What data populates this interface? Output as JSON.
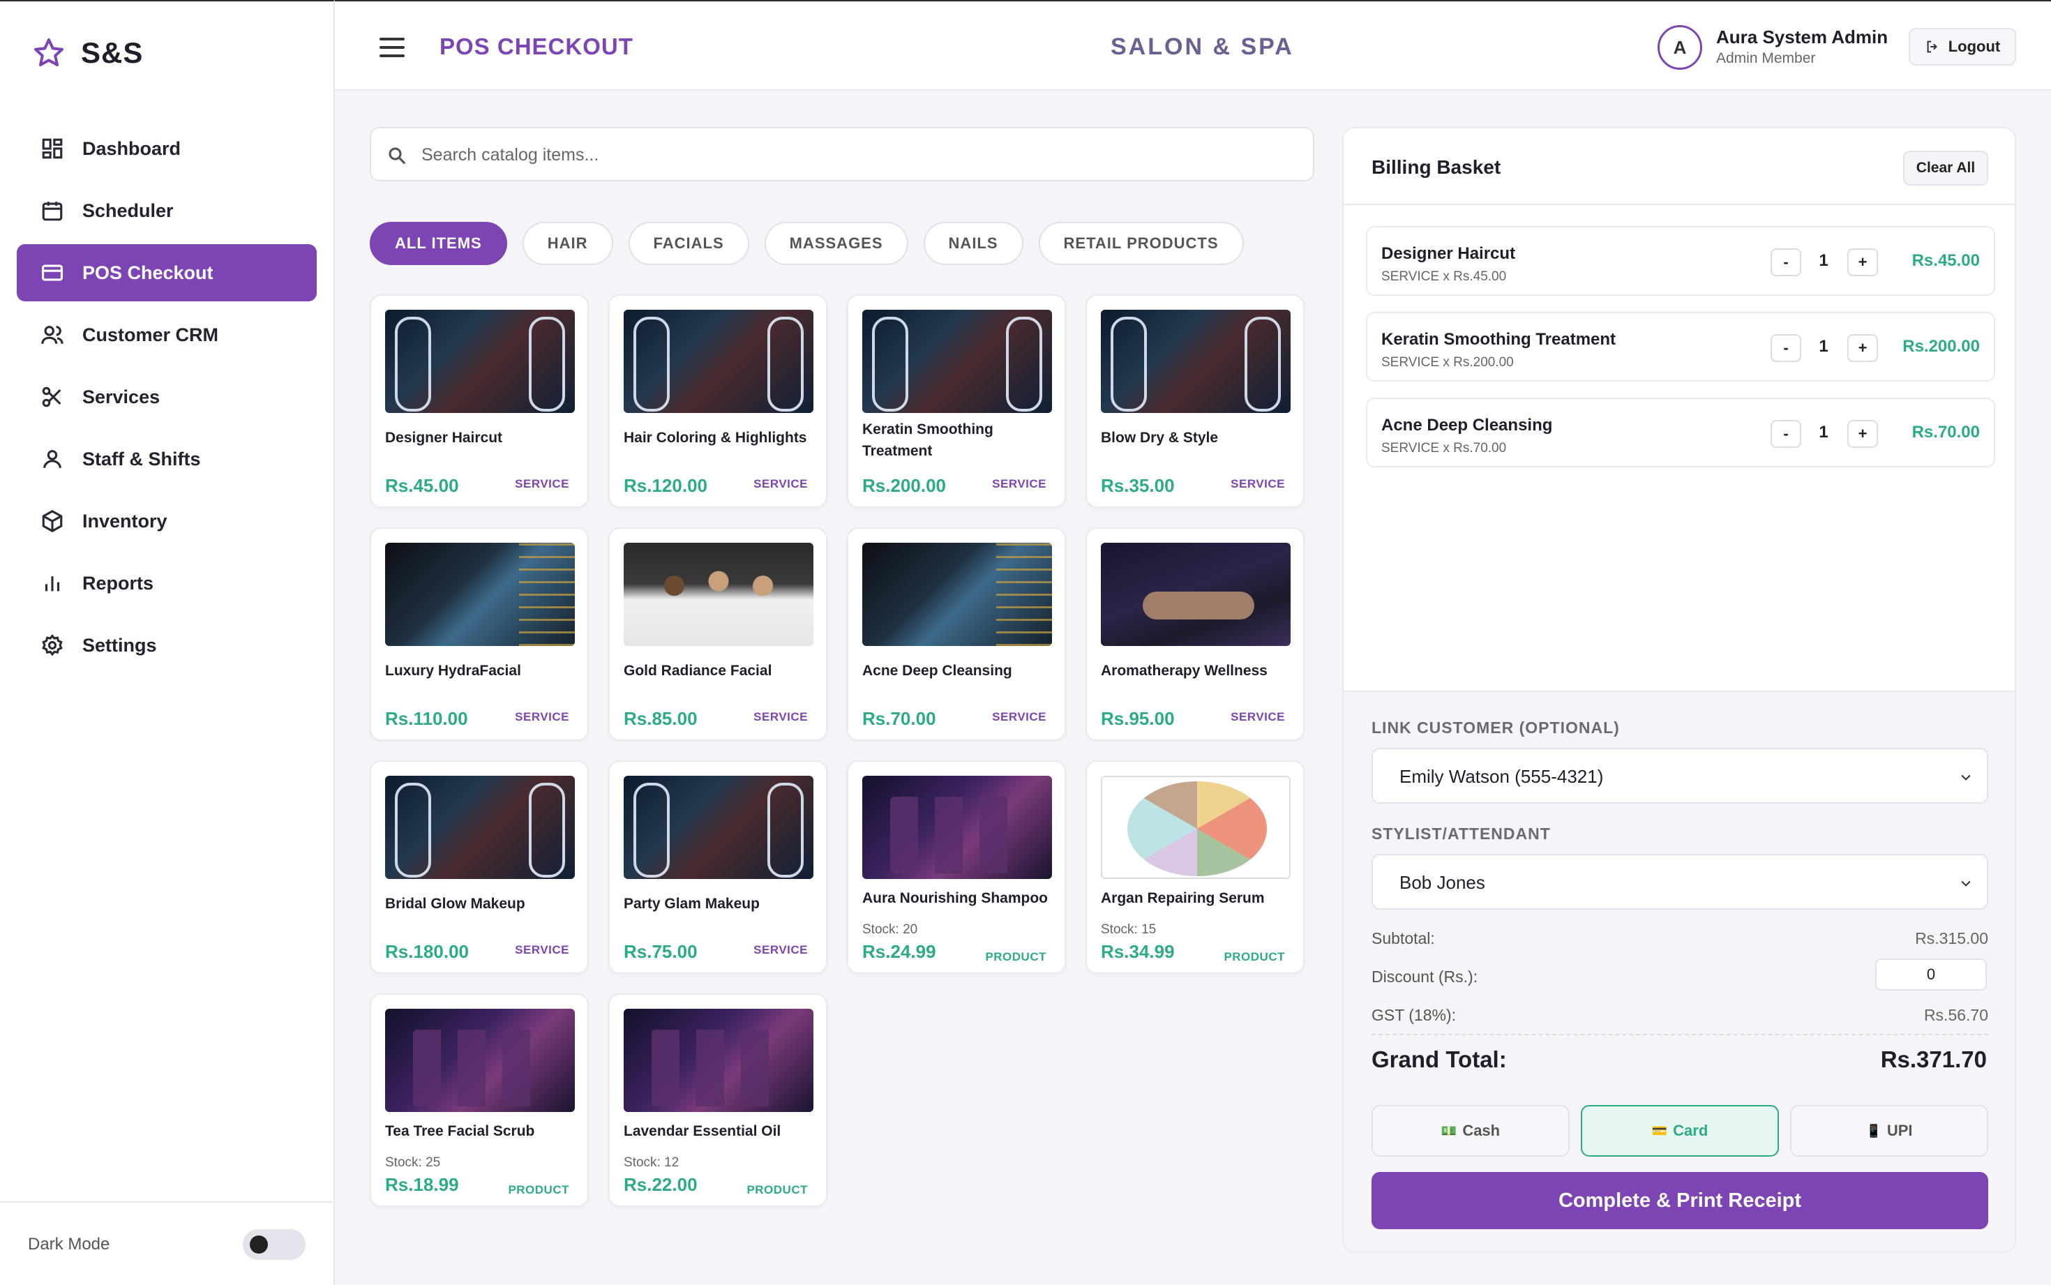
{
  "brand": {
    "name": "S&S"
  },
  "sidebar": {
    "items": [
      {
        "label": "Dashboard",
        "icon": "dashboard-icon"
      },
      {
        "label": "Scheduler",
        "icon": "calendar-icon"
      },
      {
        "label": "POS Checkout",
        "icon": "credit-card-icon",
        "active": true
      },
      {
        "label": "Customer CRM",
        "icon": "users-icon"
      },
      {
        "label": "Services",
        "icon": "scissors-icon"
      },
      {
        "label": "Staff & Shifts",
        "icon": "user-icon"
      },
      {
        "label": "Inventory",
        "icon": "box-icon"
      },
      {
        "label": "Reports",
        "icon": "bar-chart-icon"
      },
      {
        "label": "Settings",
        "icon": "gear-icon"
      }
    ],
    "dark_mode_label": "Dark Mode",
    "dark_mode": false
  },
  "header": {
    "page_title": "POS CHECKOUT",
    "center_title": "SALON & SPA",
    "avatar_initial": "A",
    "user_name": "Aura System Admin",
    "user_role": "Admin Member",
    "logout_label": "Logout"
  },
  "catalog": {
    "search_placeholder": "Search catalog items...",
    "tabs": [
      "ALL ITEMS",
      "HAIR",
      "FACIALS",
      "MASSAGES",
      "NAILS",
      "RETAIL PRODUCTS"
    ],
    "active_tab": "ALL ITEMS",
    "items": [
      {
        "name": "Designer Haircut",
        "price": "Rs.45.00",
        "tag": "SERVICE",
        "image": "hair"
      },
      {
        "name": "Hair Coloring & Highlights",
        "price": "Rs.120.00",
        "tag": "SERVICE",
        "image": "hair"
      },
      {
        "name": "Keratin Smoothing Treatment",
        "price": "Rs.200.00",
        "tag": "SERVICE",
        "image": "hair"
      },
      {
        "name": "Blow Dry & Style",
        "price": "Rs.35.00",
        "tag": "SERVICE",
        "image": "hair"
      },
      {
        "name": "Luxury HydraFacial",
        "price": "Rs.110.00",
        "tag": "SERVICE",
        "image": "facial"
      },
      {
        "name": "Gold Radiance Facial",
        "price": "Rs.85.00",
        "tag": "SERVICE",
        "image": "crew"
      },
      {
        "name": "Acne Deep Cleansing",
        "price": "Rs.70.00",
        "tag": "SERVICE",
        "image": "facial"
      },
      {
        "name": "Aromatherapy Wellness",
        "price": "Rs.95.00",
        "tag": "SERVICE",
        "image": "massage"
      },
      {
        "name": "Bridal Glow Makeup",
        "price": "Rs.180.00",
        "tag": "SERVICE",
        "image": "hair"
      },
      {
        "name": "Party Glam Makeup",
        "price": "Rs.75.00",
        "tag": "SERVICE",
        "image": "hair"
      },
      {
        "name": "Aura Nourishing Shampoo",
        "stock": "Stock: 20",
        "price": "Rs.24.99",
        "tag": "PRODUCT",
        "image": "product"
      },
      {
        "name": "Argan Repairing Serum",
        "stock": "Stock: 15",
        "price": "Rs.34.99",
        "tag": "PRODUCT",
        "image": "food"
      },
      {
        "name": "Tea Tree Facial Scrub",
        "stock": "Stock: 25",
        "price": "Rs.18.99",
        "tag": "PRODUCT",
        "image": "product"
      },
      {
        "name": "Lavendar Essential Oil",
        "stock": "Stock: 12",
        "price": "Rs.22.00",
        "tag": "PRODUCT",
        "image": "product"
      }
    ]
  },
  "basket": {
    "title": "Billing Basket",
    "clear_label": "Clear All",
    "lines": [
      {
        "name": "Designer Haircut",
        "sub": "SERVICE x Rs.45.00",
        "qty": "1",
        "total": "Rs.45.00"
      },
      {
        "name": "Keratin Smoothing Treatment",
        "sub": "SERVICE x Rs.200.00",
        "qty": "1",
        "total": "Rs.200.00"
      },
      {
        "name": "Acne Deep Cleansing",
        "sub": "SERVICE x Rs.70.00",
        "qty": "1",
        "total": "Rs.70.00"
      }
    ],
    "minus_label": "-",
    "plus_label": "+",
    "customer_label": "LINK CUSTOMER (OPTIONAL)",
    "customer_value": "Emily Watson (555-4321)",
    "stylist_label": "STYLIST/ATTENDANT",
    "stylist_value": "Bob Jones",
    "subtotal_label": "Subtotal:",
    "subtotal_value": "Rs.315.00",
    "discount_label": "Discount (Rs.):",
    "discount_value": "0",
    "gst_label": "GST (18%):",
    "gst_value": "Rs.56.70",
    "grand_label": "Grand Total:",
    "grand_value": "Rs.371.70",
    "payments": [
      {
        "label": "Cash",
        "icon": "cash-icon"
      },
      {
        "label": "Card",
        "icon": "card-icon",
        "active": true
      },
      {
        "label": "UPI",
        "icon": "phone-icon"
      }
    ],
    "complete_label": "Complete & Print Receipt"
  },
  "colors": {
    "accent": "#7d45b3",
    "price": "#2daa8a"
  }
}
